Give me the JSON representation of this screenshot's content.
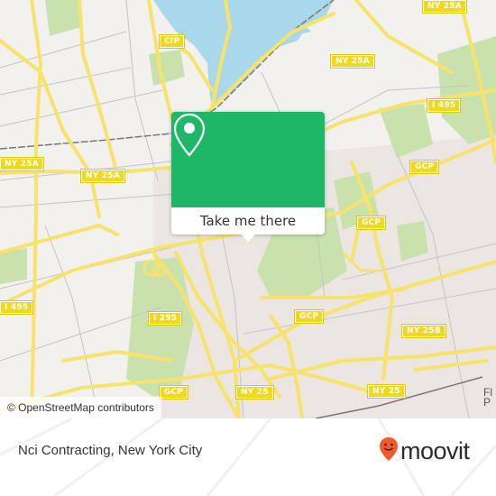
{
  "map": {
    "road_labels": [
      {
        "id": "cip",
        "text": "CIP"
      },
      {
        "id": "ny25a-top",
        "text": "NY 25A"
      },
      {
        "id": "ny25a-center",
        "text": "NY 25A"
      },
      {
        "id": "ny25a-left",
        "text": "NY 25A"
      },
      {
        "id": "ny25a-mid",
        "text": "NY 25A"
      },
      {
        "id": "i495-right",
        "text": "I 495"
      },
      {
        "id": "gcp-right",
        "text": "GCP"
      },
      {
        "id": "gcp-mid-right",
        "text": "GCP"
      },
      {
        "id": "i495-left",
        "text": "I 495"
      },
      {
        "id": "i295",
        "text": "I 295"
      },
      {
        "id": "gcp-center",
        "text": "GCP"
      },
      {
        "id": "ny25b",
        "text": "NY 25B"
      },
      {
        "id": "gcp-bottom",
        "text": "GCP"
      },
      {
        "id": "ny25-bottom-mid",
        "text": "NY 25"
      },
      {
        "id": "ny25-bottom-right",
        "text": "NY 25"
      }
    ],
    "place_fragment": "Fl\nP",
    "colors": {
      "land": "#f2f1ee",
      "water": "#a8d8ea",
      "park": "#c9e2ad",
      "road_major": "#f7e36c",
      "road_minor": "#bdbdbd",
      "urban": "#e9e4e0",
      "shield": "#f0d81e"
    }
  },
  "popup": {
    "icon": "location-pin-icon",
    "button_label": "Take me there",
    "accent_color": "#1db767"
  },
  "attribution": {
    "text": "© OpenStreetMap contributors"
  },
  "footer": {
    "place_name": "Nci Contracting, New York City",
    "brand_name": "moovit",
    "brand_icon": "moovit-smiley-pin-icon",
    "brand_color": "#f05a28"
  }
}
